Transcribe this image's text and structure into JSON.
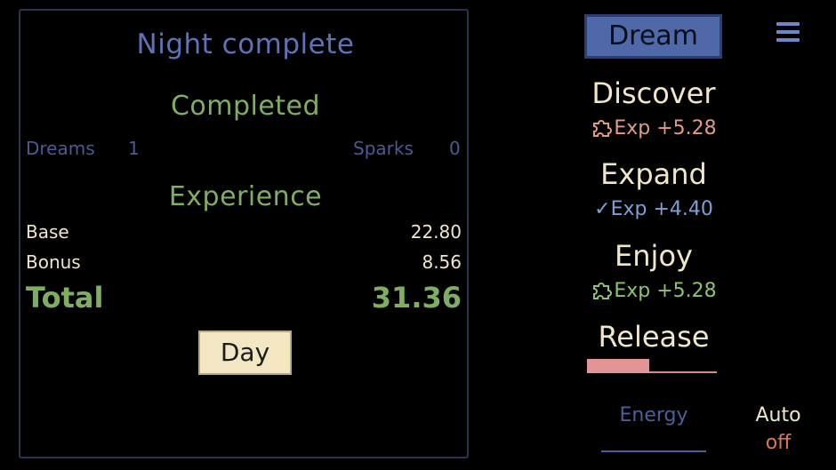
{
  "results": {
    "title": "Night complete",
    "completed_heading": "Completed",
    "dreams_label": "Dreams",
    "dreams_value": "1",
    "sparks_label": "Sparks",
    "sparks_value": "0",
    "experience_heading": "Experience",
    "base_label": "Base",
    "base_value": "22.80",
    "bonus_label": "Bonus",
    "bonus_value": "8.56",
    "total_label": "Total",
    "total_value": "31.36",
    "day_button_label": "Day"
  },
  "sidebar": {
    "dream_button_label": "Dream",
    "menu_icon": "hamburger-menu-icon",
    "actions": [
      {
        "label": "Discover",
        "reward": "Exp +5.28",
        "icon": "puzzle-icon",
        "color": "#e49a84"
      },
      {
        "label": "Expand",
        "reward": "Exp +4.40",
        "icon": "check-icon",
        "color": "#7f9fd9"
      },
      {
        "label": "Enjoy",
        "reward": "Exp +5.28",
        "icon": "puzzle-icon",
        "color": "#8cc46e"
      },
      {
        "label": "Release",
        "progress": 0.48,
        "color": "#e29595"
      }
    ],
    "energy_label": "Energy",
    "auto_label": "Auto",
    "auto_value": "off"
  },
  "colors": {
    "background": "#000000",
    "title_blue": "#5d72b8",
    "heading_green": "#7fae63",
    "cream": "#f0e6c9",
    "dream_button": "#4f68a8",
    "auto_off": "#d87a4c"
  }
}
